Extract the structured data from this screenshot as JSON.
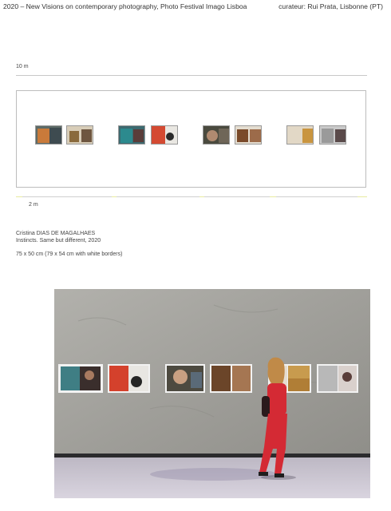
{
  "header": {
    "title": "2020 – New Visions on contemporary photography, Photo Festival Imago Lisboa",
    "curator": "curateur: Rui Prata, Lisbonne (PT)"
  },
  "plan": {
    "width_label": "10 m",
    "height_label": "2 m"
  },
  "artwork": {
    "artist": "Cristina DIAS DE MAGALHAES",
    "title": "Instincts. Same but different, 2020",
    "dimensions": "75 x 50 cm (79 x 54 cm with white borders)"
  },
  "colors": {
    "wall": "#a4a39e",
    "floor": "#cdc9d4",
    "coat": "#d42a34"
  }
}
